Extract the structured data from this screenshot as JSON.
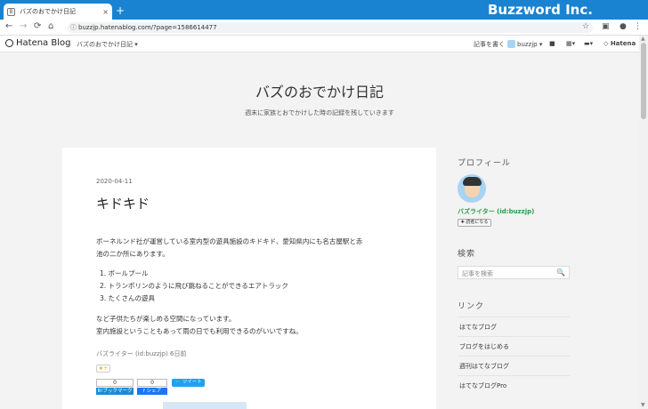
{
  "browser": {
    "tab_title": "バズのおでかけ日記",
    "tab_close": "×",
    "new_tab": "+",
    "brand": "Buzzword Inc.",
    "url": "buzzjp.hatenablog.com/?page=1586614477",
    "nav": {
      "back": "←",
      "forward": "→",
      "reload": "⟳",
      "home": "⌂"
    }
  },
  "hatena_bar": {
    "logo": "Hatena Blog",
    "blog_menu": "バズのおでかけ日記 ▾",
    "write": "記事を書く",
    "user": "buzzjp ▾",
    "hatena": "Hatena"
  },
  "blog": {
    "title": "バズのおでかけ日記",
    "description": "週末に家族とおでかけした時の記録を残していきます"
  },
  "article": {
    "date": "2020-04-11",
    "title": "キドキド",
    "para1_line1": "ボーネルンド社が運営している室内型の遊具施設のキドキド、愛知県内にも名古屋駅と赤",
    "para1_line2": "池の二か所にあります。",
    "list": [
      "1. ボールプール",
      "2. トランポリンのように飛び跳ねることができるエアトラック",
      "3. たくさんの遊具"
    ],
    "para2_line1": "など子供たちが楽しめる空間になっています。",
    "para2_line2": "室内施設ということもあって雨の日でも利用できるのがいいですね。",
    "byline": "バズライター (id:buzzjp) 6日前",
    "star": "★+",
    "bookmark_count": "0",
    "bookmark_label": "B!ブックマーク",
    "share_count": "0",
    "share_label": "f シェア",
    "tweet_label": "ツイート"
  },
  "sidebar": {
    "profile_heading": "プロフィール",
    "profile_name": "バズライター (id:buzzjp)",
    "reader_button": "✚ 読者になる",
    "search_heading": "検索",
    "search_placeholder": "記事を検索",
    "links_heading": "リンク",
    "links": [
      "はてなブログ",
      "ブログをはじめる",
      "週刊はてなブログ",
      "はてなブログPro"
    ]
  }
}
